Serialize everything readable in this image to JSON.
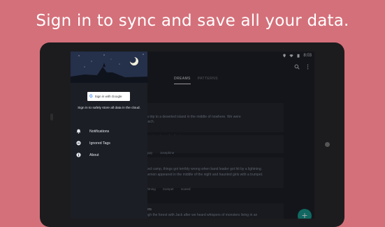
{
  "promo": {
    "title": "Sign in to sync and save all your data."
  },
  "status": {
    "time": "8:03"
  },
  "tabs": [
    {
      "label": "DREAMS",
      "active": true
    },
    {
      "label": "PATTERNS",
      "active": false
    }
  ],
  "cards": [
    {
      "lines": [
        "n a trip to a deserted island in the middle of nowhere. We were",
        "beach."
      ],
      "tags": [
        "o",
        "beach",
        "family trip"
      ]
    },
    {
      "lines": [],
      "tags": [
        "happy",
        "Josephine"
      ]
    },
    {
      "lines": [
        "band camp, things got terribly wrong when band leader got hit by a lightning.",
        "daemon appeared in the middle of the night and haunted girls with a trumpet."
      ],
      "tags": [
        "lightning",
        "trumpet",
        "scared"
      ]
    },
    {
      "lines": [
        "sters",
        "ough the forest with Jack after we heard whispers of monsters living in an"
      ],
      "tags": []
    }
  ],
  "drawer": {
    "signin_button": "Sign in with Google",
    "signin_text": "Sign in to safely store all data in the cloud.",
    "items": [
      {
        "label": "Notifications",
        "icon": "bell-icon"
      },
      {
        "label": "Ignored Tags",
        "icon": "minus-circle-icon"
      },
      {
        "label": "About",
        "icon": "info-icon"
      }
    ]
  },
  "fab": {
    "label": "+"
  },
  "colors": {
    "background": "#d4707a",
    "accent": "#1aa095",
    "screen": "#1f2129"
  }
}
